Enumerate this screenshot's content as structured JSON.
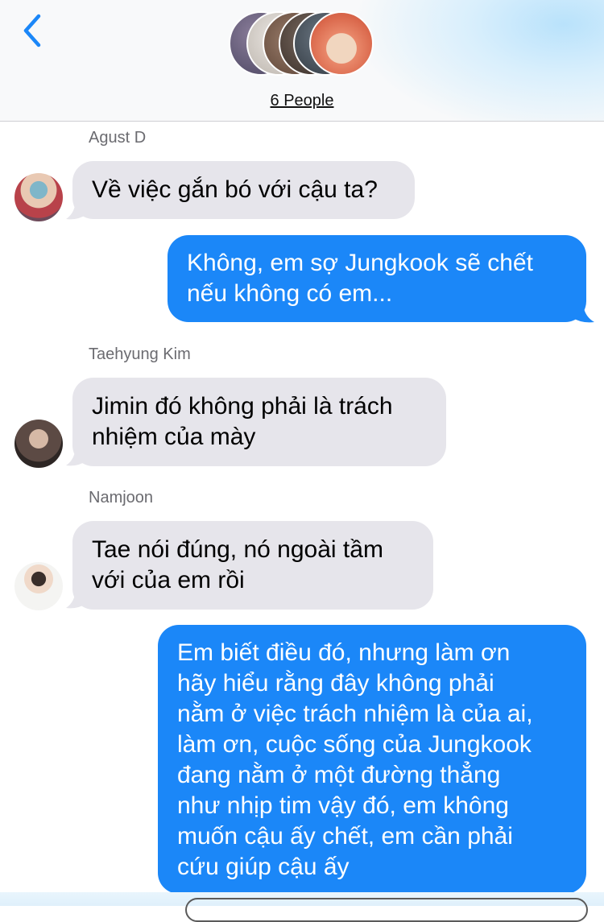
{
  "header": {
    "people_label": "6 People",
    "accent_color": "#1b87f8"
  },
  "messages": [
    {
      "sender": "Agust D",
      "text": "Về việc gắn bó với cậu ta?",
      "direction": "incoming"
    },
    {
      "text": "Không, em sợ Jungkook sẽ chết\nnếu không có em...",
      "direction": "outgoing"
    },
    {
      "sender": "Taehyung Kim",
      "text": "Jimin đó không phải là trách\nnhiệm của mày",
      "direction": "incoming"
    },
    {
      "sender": "Namjoon",
      "text": "Tae nói đúng, nó ngoài tầm\nvới của em rồi",
      "direction": "incoming"
    },
    {
      "text": "Em biết điều đó, nhưng làm ơn\nhãy hiểu rằng đây không phải\nnằm ở việc trách nhiệm là của ai,\nlàm ơn, cuộc sống của Jungkook\nđang nằm ở một đường thẳng\nnhư nhịp tim vậy đó, em không\nmuốn cậu ấy chết, em cần phải\ncứu giúp cậu ấy",
      "direction": "outgoing"
    }
  ],
  "colors": {
    "incoming_bubble": "#e6e5eb",
    "outgoing_bubble": "#1b87f8",
    "sender_text": "#6b6b70"
  }
}
